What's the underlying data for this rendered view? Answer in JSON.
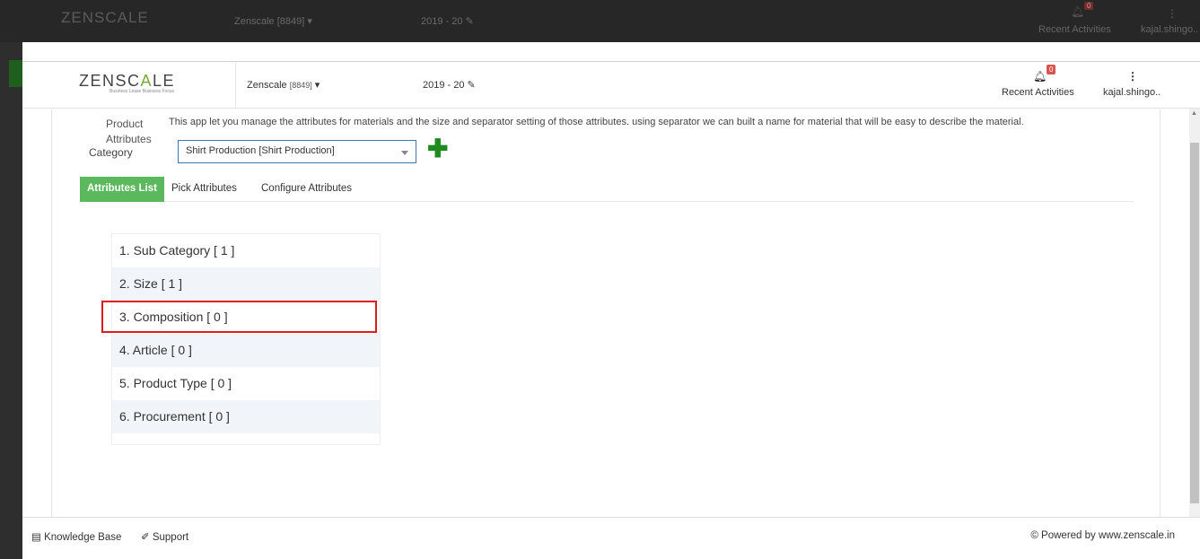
{
  "background_app": {
    "logo": "ZENSCALE",
    "company": "Zenscale [8849]",
    "year": "2019 - 20",
    "notification_count": "0",
    "recent_activities": "Recent Activities",
    "user": "kajal.shingo.."
  },
  "header": {
    "logo_text": "ZENSC",
    "logo_accent": "A",
    "logo_tail": "LE",
    "logo_tagline": "Business Lease Business Focus",
    "company_name": "Zenscale",
    "company_code": "[8849]",
    "year": "2019 - 20",
    "notification_count": "0",
    "recent_activities": "Recent Activities",
    "user": "kajal.shingo.."
  },
  "page": {
    "product_label_1": "Product",
    "product_label_2": "Attributes",
    "description": "This app let you manage the attributes for materials and the size and separator setting of those attributes. using separator we can built a name for material that will be easy to describe the material.",
    "category_label": "Category",
    "category_value": "Shirt Production [Shirt Production]"
  },
  "tabs": [
    {
      "label": "Attributes List",
      "active": true
    },
    {
      "label": "Pick Attributes",
      "active": false
    },
    {
      "label": "Configure Attributes",
      "active": false
    }
  ],
  "attributes": [
    {
      "label": "1. Sub Category [ 1 ]"
    },
    {
      "label": "2. Size [ 1 ]"
    },
    {
      "label": "3. Composition [ 0 ]"
    },
    {
      "label": "4. Article [ 0 ]"
    },
    {
      "label": "5. Product Type [ 0 ]"
    },
    {
      "label": "6. Procurement [ 0 ]"
    }
  ],
  "footer": {
    "knowledge_base": "Knowledge Base",
    "support": "Support",
    "powered_by": "© Powered by www.zenscale.in"
  },
  "colors": {
    "accent_green": "#5cb85c",
    "add_green": "#1f8a1f",
    "highlight_red": "#e01b1b",
    "badge_red": "#d9534f"
  }
}
